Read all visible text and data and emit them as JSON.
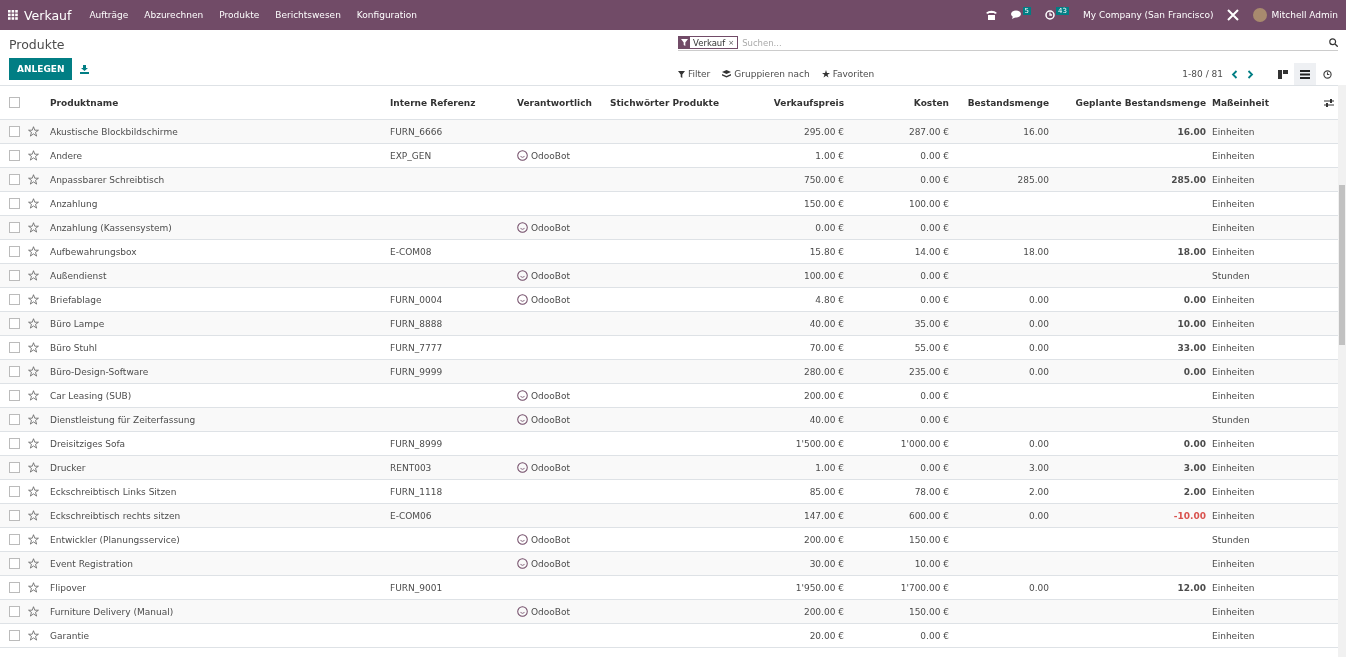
{
  "navbar": {
    "app": "Verkauf",
    "menus": [
      "Aufträge",
      "Abzurechnen",
      "Produkte",
      "Berichtswesen",
      "Konfiguration"
    ],
    "messages_count": "5",
    "activities_count": "43",
    "company": "My Company (San Francisco)",
    "user": "Mitchell Admin"
  },
  "control_panel": {
    "title": "Produkte",
    "create_button": "ANLEGEN",
    "facet": "Verkauf",
    "facet_remove": "×",
    "select_all_checked": false,
    "search_placeholder": "Suchen...",
    "filter": "Filter",
    "group_by": "Gruppieren nach",
    "favorites": "Favoriten",
    "pager": "1-80 / 81",
    "views": [
      {
        "kind": "kanban",
        "selected": false
      },
      {
        "kind": "list",
        "selected": true
      },
      {
        "kind": "activity",
        "selected": false
      }
    ]
  },
  "table": {
    "columns": [
      "Produktname",
      "Interne Referenz",
      "Verantwortlich",
      "Stichwörter Produkte",
      "Verkaufspreis",
      "Kosten",
      "Bestandsmenge",
      "Geplante Bestandsmenge",
      "Maßeinheit"
    ],
    "rows": [
      {
        "checked": false,
        "name": "Akustische Blockbildschirme",
        "ref": "FURN_6666",
        "price": "295.00 €",
        "cost": "287.00 €",
        "qty": "16.00",
        "forecast": "16.00",
        "negative": false,
        "uom": "Einheiten"
      },
      {
        "checked": false,
        "name": "Andere",
        "ref": "EXP_GEN",
        "responsible": "OdooBot",
        "price": "1.00 €",
        "cost": "0.00 €",
        "uom": "Einheiten"
      },
      {
        "checked": false,
        "name": "Anpassbarer Schreibtisch",
        "price": "750.00 €",
        "cost": "0.00 €",
        "qty": "285.00",
        "forecast": "285.00",
        "negative": false,
        "uom": "Einheiten"
      },
      {
        "checked": false,
        "name": "Anzahlung",
        "price": "150.00 €",
        "cost": "100.00 €",
        "uom": "Einheiten"
      },
      {
        "checked": false,
        "name": "Anzahlung (Kassensystem)",
        "responsible": "OdooBot",
        "price": "0.00 €",
        "cost": "0.00 €",
        "uom": "Einheiten"
      },
      {
        "checked": false,
        "name": "Aufbewahrungsbox",
        "ref": "E-COM08",
        "price": "15.80 €",
        "cost": "14.00 €",
        "qty": "18.00",
        "forecast": "18.00",
        "negative": false,
        "uom": "Einheiten"
      },
      {
        "checked": false,
        "name": "Außendienst",
        "responsible": "OdooBot",
        "price": "100.00 €",
        "cost": "0.00 €",
        "uom": "Stunden"
      },
      {
        "checked": false,
        "name": "Briefablage",
        "ref": "FURN_0004",
        "responsible": "OdooBot",
        "price": "4.80 €",
        "cost": "0.00 €",
        "qty": "0.00",
        "forecast": "0.00",
        "negative": false,
        "uom": "Einheiten"
      },
      {
        "checked": false,
        "name": "Büro Lampe",
        "ref": "FURN_8888",
        "price": "40.00 €",
        "cost": "35.00 €",
        "qty": "0.00",
        "forecast": "10.00",
        "negative": false,
        "uom": "Einheiten"
      },
      {
        "checked": false,
        "name": "Büro Stuhl",
        "ref": "FURN_7777",
        "price": "70.00 €",
        "cost": "55.00 €",
        "qty": "0.00",
        "forecast": "33.00",
        "negative": false,
        "uom": "Einheiten"
      },
      {
        "checked": false,
        "name": "Büro-Design-Software",
        "ref": "FURN_9999",
        "price": "280.00 €",
        "cost": "235.00 €",
        "qty": "0.00",
        "forecast": "0.00",
        "negative": false,
        "uom": "Einheiten"
      },
      {
        "checked": false,
        "name": "Car Leasing (SUB)",
        "responsible": "OdooBot",
        "price": "200.00 €",
        "cost": "0.00 €",
        "uom": "Einheiten"
      },
      {
        "checked": false,
        "name": "Dienstleistung für Zeiterfassung",
        "responsible": "OdooBot",
        "price": "40.00 €",
        "cost": "0.00 €",
        "uom": "Stunden"
      },
      {
        "checked": false,
        "name": "Dreisitziges Sofa",
        "ref": "FURN_8999",
        "price": "1'500.00 €",
        "cost": "1'000.00 €",
        "qty": "0.00",
        "forecast": "0.00",
        "negative": false,
        "uom": "Einheiten"
      },
      {
        "checked": false,
        "name": "Drucker",
        "ref": "RENT003",
        "responsible": "OdooBot",
        "price": "1.00 €",
        "cost": "0.00 €",
        "qty": "3.00",
        "forecast": "3.00",
        "negative": false,
        "uom": "Einheiten"
      },
      {
        "checked": false,
        "name": "Eckschreibtisch Links Sitzen",
        "ref": "FURN_1118",
        "price": "85.00 €",
        "cost": "78.00 €",
        "qty": "2.00",
        "forecast": "2.00",
        "negative": false,
        "uom": "Einheiten"
      },
      {
        "checked": false,
        "name": "Eckschreibtisch rechts sitzen",
        "ref": "E-COM06",
        "price": "147.00 €",
        "cost": "600.00 €",
        "qty": "0.00",
        "forecast": "-10.00",
        "negative": true,
        "uom": "Einheiten"
      },
      {
        "checked": false,
        "name": "Entwickler (Planungsservice)",
        "responsible": "OdooBot",
        "price": "200.00 €",
        "cost": "150.00 €",
        "uom": "Stunden"
      },
      {
        "checked": false,
        "name": "Event Registration",
        "responsible": "OdooBot",
        "price": "30.00 €",
        "cost": "10.00 €",
        "uom": "Einheiten"
      },
      {
        "checked": false,
        "name": "Flipover",
        "ref": "FURN_9001",
        "price": "1'950.00 €",
        "cost": "1'700.00 €",
        "qty": "0.00",
        "forecast": "12.00",
        "negative": false,
        "uom": "Einheiten"
      },
      {
        "checked": false,
        "name": "Furniture Delivery (Manual)",
        "responsible": "OdooBot",
        "price": "200.00 €",
        "cost": "150.00 €",
        "uom": "Einheiten"
      },
      {
        "checked": false,
        "name": "Garantie",
        "price": "20.00 €",
        "cost": "0.00 €",
        "uom": "Einheiten"
      }
    ]
  }
}
